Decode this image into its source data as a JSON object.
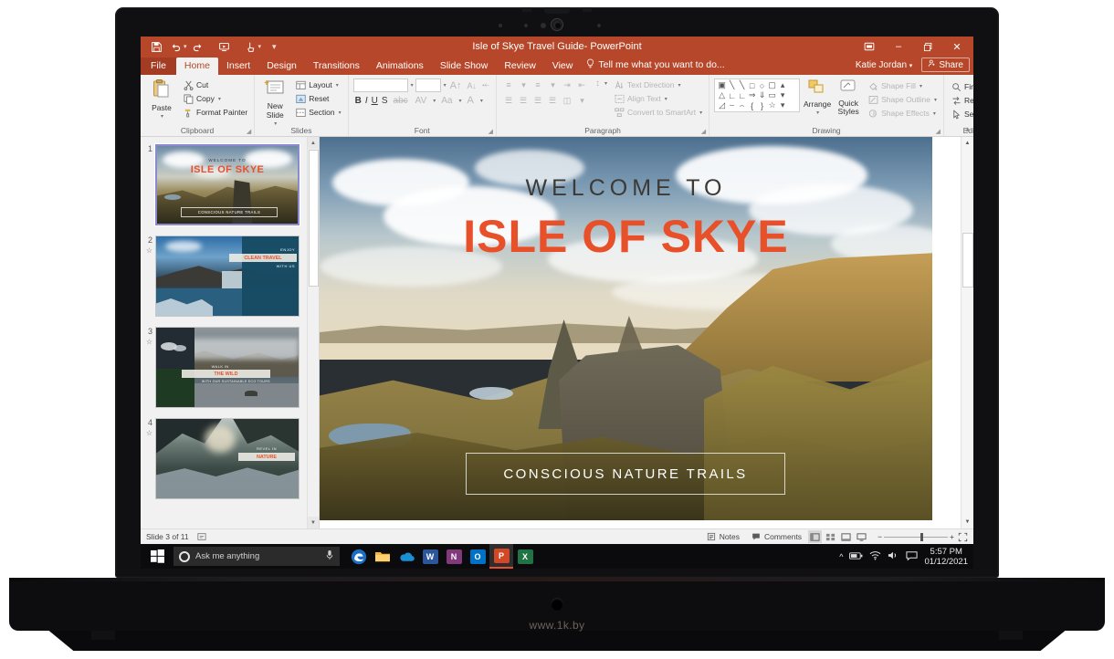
{
  "window": {
    "title": "Isle of Skye Travel Guide- PowerPoint",
    "minimize": "–",
    "restore": "❐",
    "close": "✕",
    "ribbon_display_options": "ribbon-display-options-icon",
    "accent_color": "#b7472a"
  },
  "quick_access": [
    {
      "name": "save-icon",
      "glyph": "💾"
    },
    {
      "name": "undo-icon",
      "glyph": "↶"
    },
    {
      "name": "redo-icon",
      "glyph": "↷"
    },
    {
      "name": "start-from-beginning-icon",
      "glyph": "▣"
    },
    {
      "name": "touch-mode-icon",
      "glyph": "☝"
    },
    {
      "name": "customize-quick-access-icon",
      "glyph": "▾"
    }
  ],
  "menu": {
    "file": "File",
    "tabs": [
      "Home",
      "Insert",
      "Design",
      "Transitions",
      "Animations",
      "Slide Show",
      "Review",
      "View"
    ],
    "active_tab": "Home",
    "tell_me": "Tell me what you want to do...",
    "account": "Katie Jordan",
    "share": "Share"
  },
  "ribbon": {
    "groups": [
      {
        "label": "Clipboard",
        "big": {
          "label": "Paste",
          "icon": "paste-icon"
        },
        "items": [
          {
            "label": "Cut",
            "icon": "cut-icon"
          },
          {
            "label": "Copy",
            "icon": "copy-icon"
          },
          {
            "label": "Format Painter",
            "icon": "format-painter-icon"
          }
        ]
      },
      {
        "label": "Slides",
        "big": {
          "label": "New Slide",
          "icon": "new-slide-icon"
        },
        "items": [
          {
            "label": "Layout",
            "icon": "layout-icon"
          },
          {
            "label": "Reset",
            "icon": "reset-icon"
          },
          {
            "label": "Section",
            "icon": "section-icon"
          }
        ]
      },
      {
        "label": "Font",
        "font_name": "",
        "font_size": "",
        "buttons": [
          "B",
          "I",
          "U",
          "S"
        ]
      },
      {
        "label": "Paragraph",
        "items": [
          {
            "label": "Text Direction",
            "icon": "text-direction-icon"
          },
          {
            "label": "Align Text",
            "icon": "align-text-icon"
          },
          {
            "label": "Convert to SmartArt",
            "icon": "smartart-icon"
          }
        ]
      },
      {
        "label": "Drawing",
        "arrange": "Arrange",
        "quick_styles": "Quick Styles",
        "items": [
          {
            "label": "Shape Fill",
            "icon": "shape-fill-icon"
          },
          {
            "label": "Shape Outline",
            "icon": "shape-outline-icon"
          },
          {
            "label": "Shape Effects",
            "icon": "shape-effects-icon"
          }
        ]
      },
      {
        "label": "Editing",
        "items": [
          {
            "label": "Find",
            "icon": "find-icon"
          },
          {
            "label": "Replace",
            "icon": "replace-icon"
          },
          {
            "label": "Select",
            "icon": "select-icon"
          }
        ]
      }
    ]
  },
  "thumbnails": [
    {
      "number": "1",
      "selected": true,
      "starred": false,
      "lines": [
        "WELCOME TO",
        "ISLE OF SKYE",
        "CONSCIOUS NATURE TRAILS"
      ]
    },
    {
      "number": "2",
      "selected": false,
      "starred": true,
      "lines": [
        "ENJOY",
        "CLEAN TRAVEL",
        "WITH US"
      ]
    },
    {
      "number": "3",
      "selected": false,
      "starred": true,
      "lines": [
        "WALK IN",
        "THE WILD",
        "WITH OUR SUSTAINABLE ECO TOURS"
      ]
    },
    {
      "number": "4",
      "selected": false,
      "starred": true,
      "lines": [
        "REVEL IN",
        "NATURE"
      ]
    }
  ],
  "slide": {
    "eyebrow": "WELCOME TO",
    "title": "ISLE OF SKYE",
    "cta": "CONSCIOUS NATURE TRAILS",
    "title_color": "#e8502a"
  },
  "status_bar": {
    "slide_counter": "Slide 3 of 11",
    "language_icon": "accessibility-icon",
    "notes": "Notes",
    "comments": "Comments",
    "views": [
      "normal-view-icon",
      "slide-sorter-icon",
      "reading-view-icon",
      "slide-show-icon"
    ],
    "active_view": "normal-view-icon",
    "zoom_out": "−",
    "zoom_in": "+",
    "fit_to_window": "fit-slide-icon"
  },
  "taskbar": {
    "start": "start-icon",
    "search_placeholder": "Ask me anything",
    "mic": "microphone-icon",
    "apps": [
      {
        "name": "edge-icon",
        "glyph": "e",
        "color": "#1a6fc4",
        "text": "#ffffff"
      },
      {
        "name": "file-explorer-icon",
        "glyph": "▬",
        "color": "#f3b43a",
        "text": "#8a5a00"
      },
      {
        "name": "onedrive-icon",
        "glyph": "☁",
        "color": "#1a8fd4",
        "text": "#ffffff"
      },
      {
        "name": "word-icon",
        "glyph": "W",
        "color": "#2b579a",
        "text": "#ffffff"
      },
      {
        "name": "onenote-icon",
        "glyph": "N",
        "color": "#80397b",
        "text": "#ffffff"
      },
      {
        "name": "outlook-icon",
        "glyph": "O",
        "color": "#0072c6",
        "text": "#ffffff"
      },
      {
        "name": "powerpoint-icon",
        "glyph": "P",
        "color": "#d24726",
        "text": "#ffffff",
        "active": true
      },
      {
        "name": "excel-icon",
        "glyph": "X",
        "color": "#217346",
        "text": "#ffffff"
      }
    ],
    "tray": [
      "show-hidden-icons-icon",
      "battery-icon",
      "wifi-icon",
      "volume-icon",
      "action-center-icon"
    ],
    "time": "5:57 PM",
    "date": "01/12/2021"
  },
  "photo_credit": "www.1k.by"
}
